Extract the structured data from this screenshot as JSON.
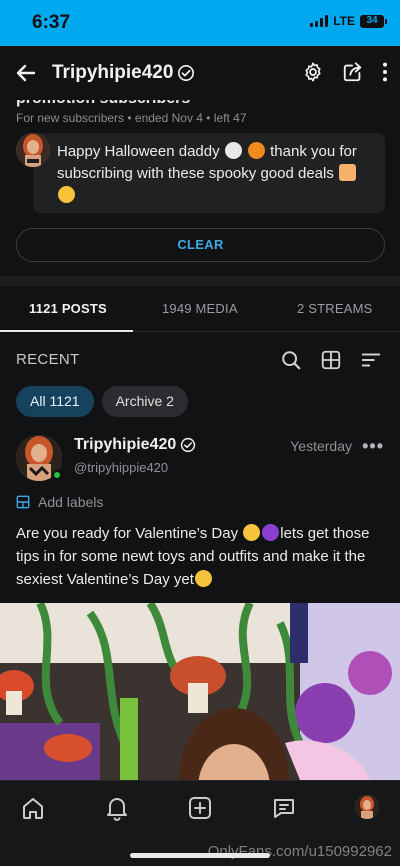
{
  "status_bar": {
    "time": "6:37",
    "network": "LTE",
    "battery": "34"
  },
  "header": {
    "title": "Tripyhipie420"
  },
  "promotion": {
    "title_partial": "promotion subscribers",
    "meta": "For new subscribers  •  ended Nov 4  •  left 47",
    "message_line1": "Happy Halloween daddy",
    "message_line1_end": " thank you for",
    "message_line2": "subscribing with these spooky good deals",
    "clear_label": "CLEAR"
  },
  "tabs": [
    {
      "label": "1121 POSTS",
      "active": true
    },
    {
      "label": "1949 MEDIA",
      "active": false
    },
    {
      "label": "2 STREAMS",
      "active": false
    }
  ],
  "recent": {
    "label": "RECENT"
  },
  "filters": [
    {
      "label": "All 1121",
      "active": true
    },
    {
      "label": "Archive 2",
      "active": false
    }
  ],
  "post": {
    "name": "Tripyhipie420",
    "handle": "@tripyhippie420",
    "time": "Yesterday",
    "more": "•••",
    "add_labels": "Add labels",
    "text_part1": "Are you ready for Valentine’s Day ",
    "text_part2": "lets get those tips in for some newt toys and outfits and make it the sexiest Valentine’s Day yet"
  },
  "watermark": "OnlyFans.com/u150992962",
  "colors": {
    "accent": "#00a8f0",
    "link": "#3fa6e6",
    "chip_active": "#16425d",
    "online": "#25c43c"
  },
  "icons": [
    "back-arrow-icon",
    "verified-badge-icon",
    "gear-icon",
    "share-icon",
    "more-vertical-icon",
    "search-icon",
    "grid-icon",
    "sort-icon",
    "label-icon",
    "home-icon",
    "bell-icon",
    "add-post-icon",
    "messages-icon"
  ]
}
